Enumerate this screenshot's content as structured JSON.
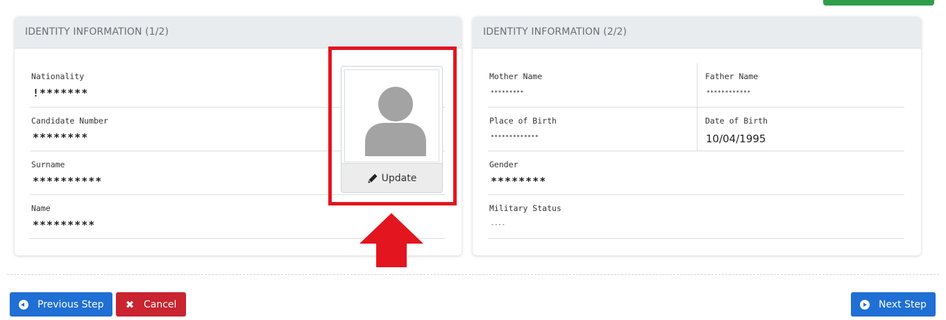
{
  "left_card": {
    "title": "IDENTITY INFORMATION (1/2)",
    "fields": [
      {
        "label": "Nationality",
        "value": "!*******"
      },
      {
        "label": "Candidate Number",
        "value": "********"
      },
      {
        "label": "Surname",
        "value": "**********"
      },
      {
        "label": "Name",
        "value": "*********"
      }
    ],
    "photo": {
      "update_label": "Update",
      "avatar_icon": "user-silhouette-icon",
      "edit_icon": "pencil-icon"
    }
  },
  "right_card": {
    "title": "IDENTITY INFORMATION (2/2)",
    "mother_name": {
      "label": "Mother Name",
      "value": "*********"
    },
    "father_name": {
      "label": "Father Name",
      "value": "************"
    },
    "place_of_birth": {
      "label": "Place of Birth",
      "value": "*************"
    },
    "date_of_birth": {
      "label": "Date of Birth",
      "value": "10/04/1995"
    },
    "gender": {
      "label": "Gender",
      "value": "********"
    },
    "military_status": {
      "label": "Military Status",
      "value": "----"
    }
  },
  "footer": {
    "previous_label": "Previous Step",
    "cancel_label": "Cancel",
    "next_label": "Next Step"
  },
  "colors": {
    "primary": "#1f6fd4",
    "danger": "#c9242f",
    "highlight": "#e3151f",
    "success": "#2e9e4b"
  }
}
